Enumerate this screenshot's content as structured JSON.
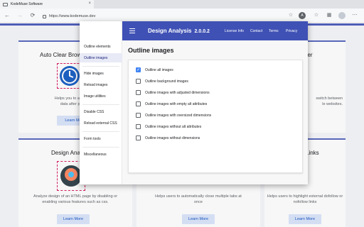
{
  "browser": {
    "tab_title": "KodeMuse Software",
    "tab_close": "×",
    "url": "https://www.kodemuse.dev",
    "nav_back": "←",
    "nav_forward": "→",
    "nav_reload": "⟳",
    "extension_badge": "A"
  },
  "page": {
    "cards": [
      {
        "title": "Auto Clear Brow",
        "desc": "Helps you to automatically c\ndata after pre-defined",
        "learn": "Learn Mo"
      },
      {
        "title": "her",
        "desc": "switch between\nle websites.",
        "learn": ""
      },
      {
        "title": "Design Anal",
        "desc": "Analyze design of an HTML page by disabling or\nenabling various features such as css.",
        "learn": "Learn More"
      },
      {
        "title": "",
        "desc": "Helps users to automatically close multiple tabs at\nonce",
        "learn": "Learn More"
      },
      {
        "title": "Links",
        "desc": "Helps users to highlight external dofollow or\nnofollow links",
        "learn": "Learn More"
      }
    ]
  },
  "popup": {
    "title": "Design Analysis",
    "version": "2.0.0.2",
    "header_links": [
      "License Info",
      "Contact",
      "Terms",
      "Privacy"
    ],
    "sidebar": [
      "Outline elements",
      "Outline images",
      "Hide images",
      "Reload images",
      "Image utilities",
      "Disable CSS",
      "Reload external CSS",
      "Form tools",
      "Miscellaneous"
    ],
    "content_title": "Outline images",
    "options": [
      {
        "label": "Outline all images",
        "checked": true
      },
      {
        "label": "Outline background images",
        "checked": false
      },
      {
        "label": "Outline images with adjusted dimensions",
        "checked": false
      },
      {
        "label": "Outline images with empty alt attributes",
        "checked": false
      },
      {
        "label": "Outline images with oversized dimensions",
        "checked": false
      },
      {
        "label": "Outline images without alt attributes",
        "checked": false
      },
      {
        "label": "Outline images without dimensions",
        "checked": false
      }
    ],
    "accent_color": "#3f51b5"
  }
}
